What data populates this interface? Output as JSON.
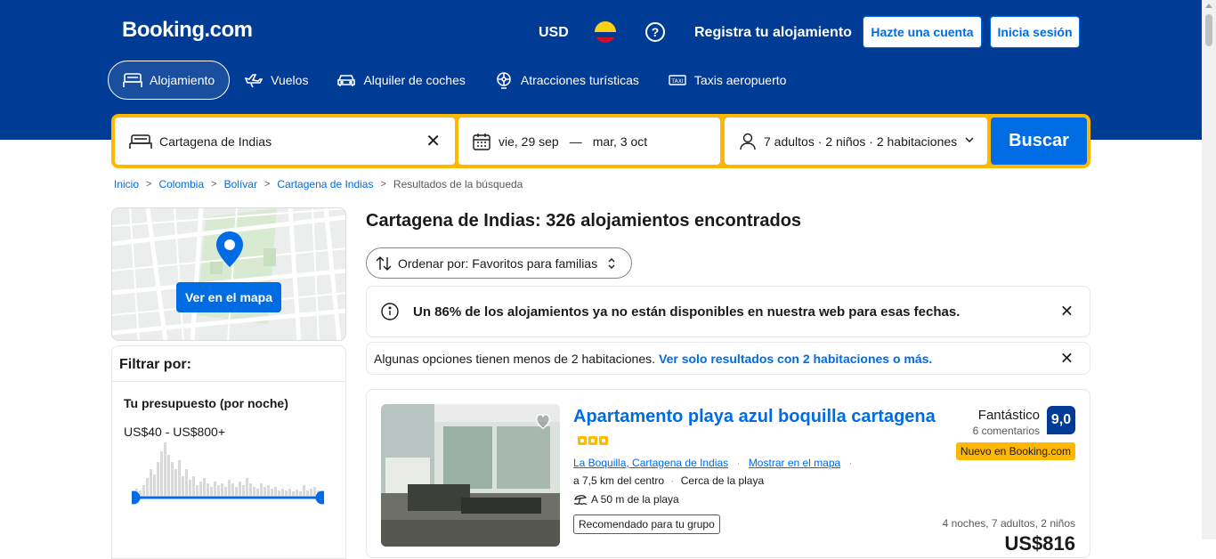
{
  "header": {
    "logo": "Booking.com",
    "currency": "USD",
    "register": "Registra tu alojamiento",
    "signup": "Hazte una cuenta",
    "signin": "Inicia sesión"
  },
  "nav": [
    {
      "label": "Alojamiento",
      "icon": "bed-icon"
    },
    {
      "label": "Vuelos",
      "icon": "plane-icon"
    },
    {
      "label": "Alquiler de coches",
      "icon": "car-icon"
    },
    {
      "label": "Atracciones turísticas",
      "icon": "attractions-icon"
    },
    {
      "label": "Taxis aeropuerto",
      "icon": "taxi-icon"
    }
  ],
  "search": {
    "destination": "Cartagena de Indias",
    "checkin": "vie, 29 sep",
    "dash": "—",
    "checkout": "mar, 3 oct",
    "guests": "7 adultos · 2 niños · 2 habitaciones",
    "button": "Buscar"
  },
  "breadcrumb": [
    "Inicio",
    "Colombia",
    "Bolívar",
    "Cartagena de Indias",
    "Resultados de la búsqueda"
  ],
  "map": {
    "button": "Ver en el mapa"
  },
  "filter": {
    "title": "Filtrar por:",
    "budget_title": "Tu presupuesto (por noche)",
    "budget_range": "US$40 - US$800+"
  },
  "results": {
    "title": "Cartagena de Indias: 326 alojamientos encontrados",
    "sort": "Ordenar por: Favoritos para familias",
    "banner1": "Un 86% de los alojamientos ya no están disponibles en nuestra web para esas fechas.",
    "banner2_text": "Algunas opciones tienen menos de 2 habitaciones.",
    "banner2_link": "Ver solo resultados con 2 habitaciones o más."
  },
  "card": {
    "title": "Apartamento playa azul boquilla cartagena",
    "stars": 3,
    "location": "La Boquilla, Cartagena de Indias",
    "map_link": "Mostrar en el mapa",
    "distance": "a 7,5 km del centro",
    "beach_near": "Cerca de la playa",
    "beach_distance": "A 50 m de la playa",
    "recommended": "Recomendado para tu grupo",
    "score_word": "Fantástico",
    "reviews": "6 comentarios",
    "score": "9,0",
    "new_badge": "Nuevo en Booking.com",
    "stay": "4 noches, 7 adultos, 2 niños",
    "price": "US$816"
  },
  "colors": {
    "brand": "#003b95",
    "accent": "#006ce4",
    "search_border": "#ffb700"
  }
}
